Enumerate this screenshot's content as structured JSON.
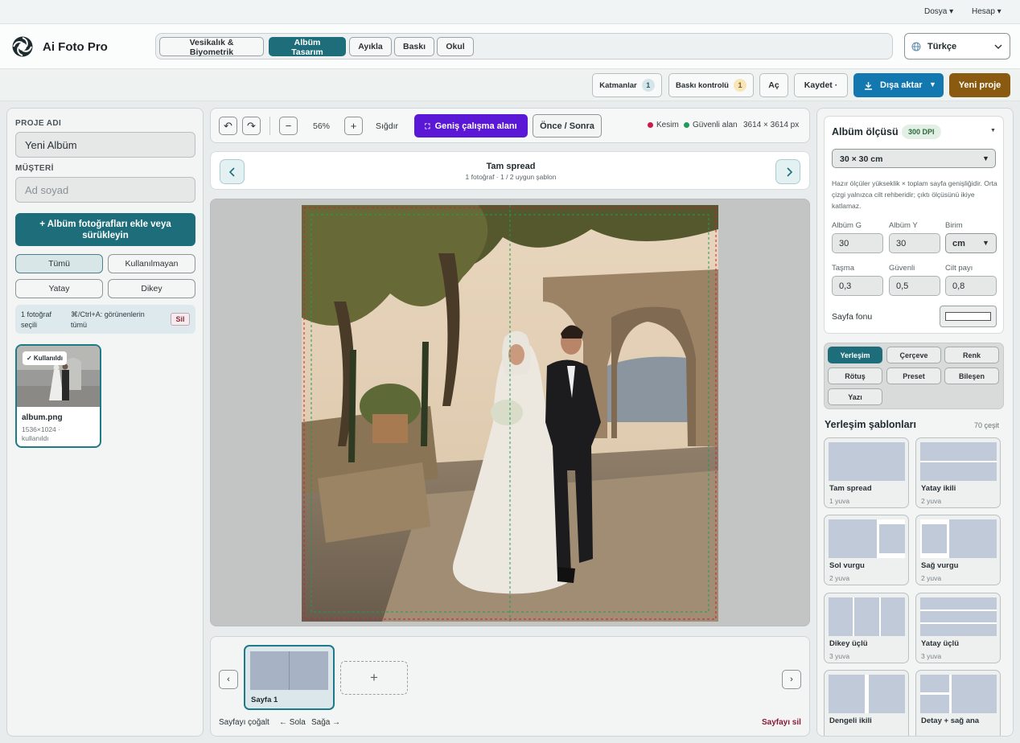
{
  "topbar": {
    "file_menu": "Dosya ▾",
    "account_menu": "Hesap ▾"
  },
  "app": {
    "name": "Ai Foto Pro"
  },
  "nav": {
    "tabs": [
      {
        "label": "Vesikalık & Biyometrik"
      },
      {
        "label": "Albüm Tasarım"
      },
      {
        "label": "Ayıkla"
      },
      {
        "label": "Baskı"
      },
      {
        "label": "Okul"
      }
    ],
    "active": "Albüm Tasarım"
  },
  "language": {
    "value": "Türkçe"
  },
  "toolbar": {
    "layers_label": "Katmanlar",
    "layers_count": "1",
    "print_check_label": "Baskı kontrolü",
    "print_check_count": "1",
    "open_label": "Aç",
    "save_label": "Kaydet ·",
    "export_label": "Dışa aktar",
    "new_project_label": "Yeni proje"
  },
  "left": {
    "project_name_label": "PROJE ADI",
    "project_name_value": "Yeni Albüm",
    "customer_label": "MÜŞTERİ",
    "customer_placeholder": "Ad soyad",
    "add_photos_label": "+ Albüm fotoğrafları ekle veya sürükleyin",
    "filters": {
      "all": "Tümü",
      "unused": "Kullanılmayan",
      "landscape": "Yatay",
      "portrait": "Dikey"
    },
    "selection": {
      "count": "1 fotoğraf seçili",
      "hint": "⌘/Ctrl+A: görünenlerin tümü",
      "delete": "Sil"
    },
    "photo": {
      "badge": "✓ Kullanıldı",
      "name": "album.png",
      "meta": "1536×1024 · kullanıldı"
    }
  },
  "canvas": {
    "zoom": "56%",
    "fit_label": "Sığdır",
    "wide_label": "Geniş çalışma alanı",
    "before_after_label": "Önce / Sonra",
    "bleed_label": "Kesim",
    "safe_label": "Güvenli alan",
    "size_label": "3614 × 3614 px",
    "layout_title": "Tam spread",
    "layout_subtitle": "1 fotoğraf · 1 / 2 uygun şablon"
  },
  "pages": {
    "page_label": "Sayfa 1",
    "duplicate_label": "Sayfayı çoğalt",
    "left_label": "← Sola",
    "right_label": "Sağa →",
    "delete_label": "Sayfayı sil"
  },
  "right": {
    "album_size_title": "Albüm ölçüsü",
    "dpi_badge": "300 DPI",
    "size_select": "30 × 30 cm",
    "size_note": "Hazır ölçüler yükseklik × toplam sayfa genişliğidir. Orta çizgi yalnızca cilt rehberidir; çıktı ölçüsünü ikiye katlamaz.",
    "width_label": "Albüm G",
    "width_value": "30",
    "height_label": "Albüm Y",
    "height_value": "30",
    "unit_label": "Birim",
    "unit_value": "cm",
    "bleed_label": "Taşma",
    "bleed_value": "0,3",
    "safe_label": "Güvenli",
    "safe_value": "0,5",
    "spine_label": "Cilt payı",
    "spine_value": "0,8",
    "bg_label": "Sayfa fonu",
    "tabs": [
      "Yerleşim",
      "Çerçeve",
      "Renk",
      "Rötuş",
      "Preset",
      "Bileşen",
      "Yazı"
    ],
    "templates_title": "Yerleşim şablonları",
    "templates_count": "70 çeşit",
    "templates": [
      {
        "name": "Tam spread",
        "slots": "1 yuva"
      },
      {
        "name": "Yatay ikili",
        "slots": "2 yuva"
      },
      {
        "name": "Sol vurgu",
        "slots": "2 yuva"
      },
      {
        "name": "Sağ vurgu",
        "slots": "2 yuva"
      },
      {
        "name": "Dikey üçlü",
        "slots": "3 yuva"
      },
      {
        "name": "Yatay üçlü",
        "slots": "3 yuva"
      },
      {
        "name": "Dengeli ikili",
        "slots": ""
      },
      {
        "name": "Detay + sağ ana",
        "slots": ""
      }
    ]
  },
  "colors": {
    "accent": "#1d6e7a",
    "export": "#1478b0",
    "new_project": "#8a5a10",
    "wide": "#5a17d6",
    "bleed": "#d0174a",
    "safe": "#1f9a5a"
  }
}
